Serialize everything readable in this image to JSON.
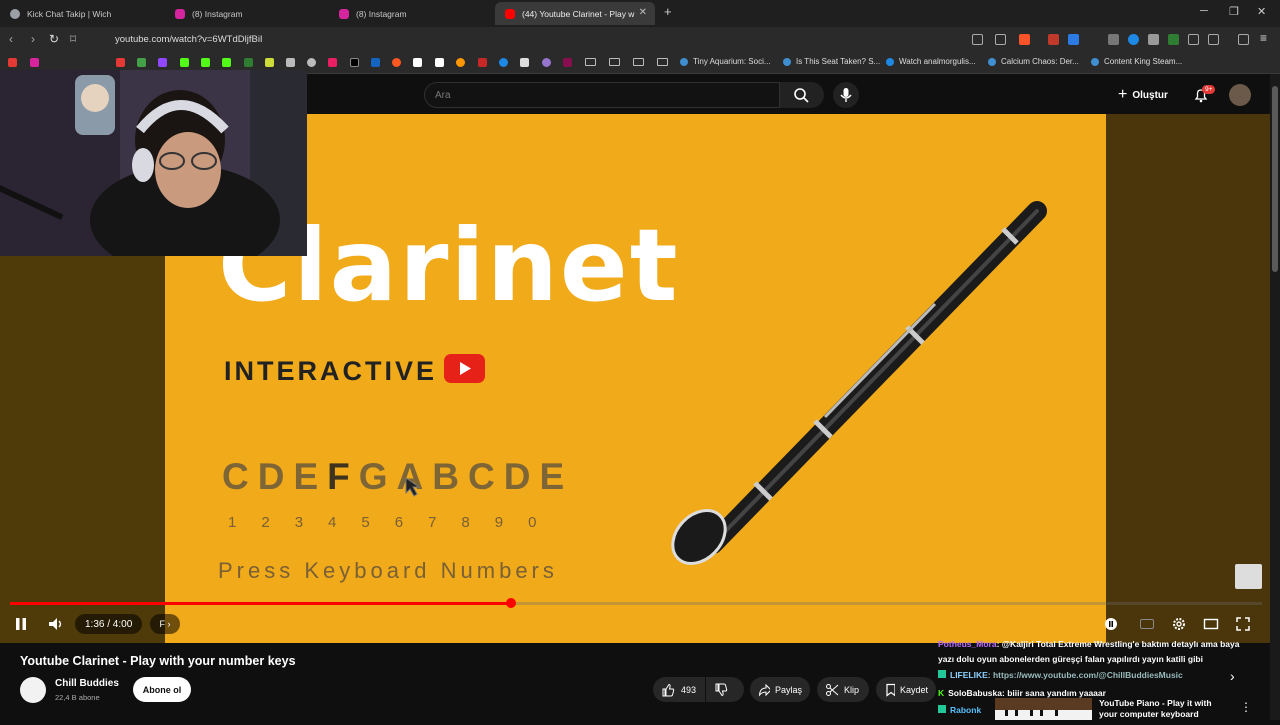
{
  "browser": {
    "tabs": [
      {
        "title": "Kick Chat Takip | Wich",
        "favicon_color": "#9aa0a6"
      },
      {
        "title": "(8) Instagram",
        "favicon_color": "#d6249f"
      },
      {
        "title": "(8) Instagram",
        "favicon_color": "#d6249f"
      },
      {
        "title": "(44) Youtube Clarinet - Play w",
        "favicon_color": "#ff0000"
      }
    ],
    "new_tab": "+",
    "url": "youtube.com/watch?v=6WTdDljfBiI",
    "bookmarks": [
      "Tiny Aquarium: Soci...",
      "Is This Seat Taken? S...",
      "Watch analmorgulis...",
      "Calcium Chaos: Der...",
      "Content King Steam..."
    ]
  },
  "youtube_header": {
    "search_placeholder": "Ara",
    "create_label": "Oluştur",
    "notification_count": "9+"
  },
  "video_frame": {
    "title": "Clarinet",
    "subtitle": "INTERACTIVE",
    "notes": [
      "C",
      "D",
      "E",
      "F",
      "G",
      "A",
      "B",
      "C",
      "D",
      "E"
    ],
    "highlighted_note": "F",
    "numbers": [
      "1",
      "2",
      "3",
      "4",
      "5",
      "6",
      "7",
      "8",
      "9",
      "0"
    ],
    "instruction": "Press Keyboard Numbers"
  },
  "player": {
    "time": "1:36 / 4:00",
    "chapter": "F",
    "progress": 0.4
  },
  "video_info": {
    "title": "Youtube Clarinet - Play with your number keys",
    "channel": "Chill Buddies",
    "subscribers": "22,4 B abone",
    "subscribe_label": "Abone ol",
    "likes": "493",
    "share_label": "Paylaş",
    "clip_label": "Klip",
    "save_label": "Kaydet"
  },
  "chat": [
    {
      "user": "Potheus_Mora",
      "text": ": @Kaljiri Total Extreme Wrestling'e baktım detaylı ama baya"
    },
    {
      "user": "",
      "text": "yazı dolu oyun abonelerden güreşçi falan yapılırdı yayın katili gibi"
    },
    {
      "user": "LIFELIKE",
      "text": ": https://www.youtube.com/@ChillBuddiesMusic"
    },
    {
      "user": "SoloBabuska",
      "text": ": biiir sana yandım yaaaar"
    },
    {
      "user": "Rabonk",
      "text": ""
    }
  ],
  "suggestion": {
    "title_line1": "YouTube Piano - Play it with",
    "title_line2": "your computer keyboard"
  }
}
